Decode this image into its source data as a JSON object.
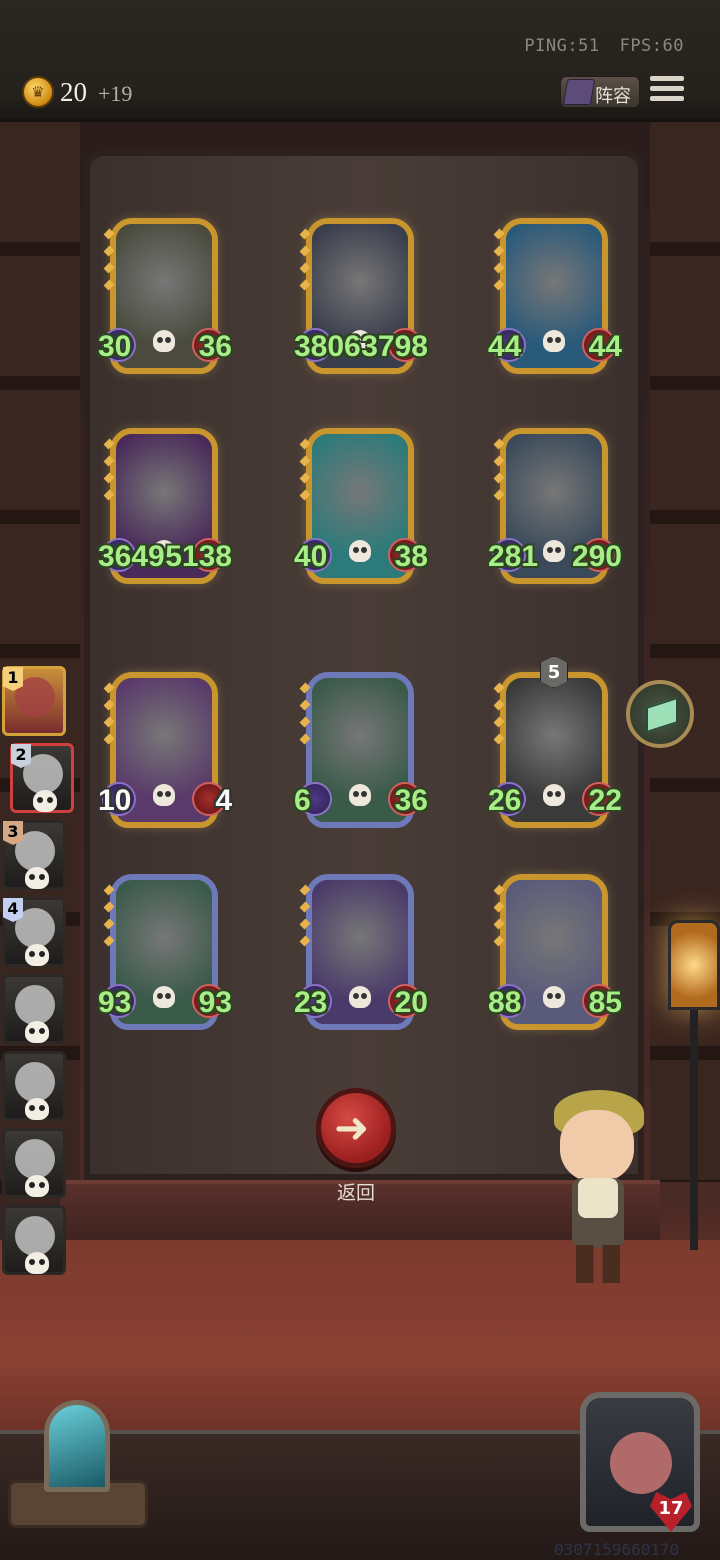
{
  "status": {
    "ping": "PING:51",
    "fps": "FPS:60"
  },
  "gold": {
    "amount": "20",
    "delta": "+19"
  },
  "top_buttons": {
    "lineup_label": "阵容"
  },
  "board": [
    {
      "atk": "30",
      "hp": "36",
      "frame": "gold",
      "art": "#4a4b3e"
    },
    {
      "atk": "3806",
      "hp": "3798",
      "frame": "gold",
      "art": "#3a3d4c"
    },
    {
      "atk": "44",
      "hp": "44",
      "frame": "gold",
      "art": "#2a5a7a"
    },
    {
      "atk": "3649",
      "hp": "5138",
      "frame": "gold",
      "art": "#4a2a5a"
    },
    {
      "atk": "40",
      "hp": "38",
      "frame": "gold",
      "art": "#2c7a7a"
    },
    {
      "atk": "281",
      "hp": "290",
      "frame": "gold",
      "art": "#3a4a5a"
    },
    {
      "atk": "10",
      "hp": "4",
      "frame": "gold",
      "art": "#5a3a6a",
      "white": true
    },
    {
      "atk": "6",
      "hp": "36",
      "frame": "blue",
      "art": "#3a5a4a"
    },
    {
      "atk": "26",
      "hp": "22",
      "frame": "gold",
      "art": "#3a3a3a",
      "level": "5"
    },
    {
      "atk": "93",
      "hp": "93",
      "frame": "blue",
      "art": "#3a5a4a"
    },
    {
      "atk": "23",
      "hp": "20",
      "frame": "blue",
      "art": "#4a3a6a"
    },
    {
      "atk": "88",
      "hp": "85",
      "frame": "gold",
      "art": "#5a5a7a"
    }
  ],
  "queue": [
    {
      "rank": "1",
      "state": "active"
    },
    {
      "rank": "2",
      "state": "selected"
    },
    {
      "rank": "3",
      "state": "dead"
    },
    {
      "rank": "4",
      "state": "dead"
    },
    {
      "rank": "",
      "state": "dead"
    },
    {
      "rank": "",
      "state": "dead"
    },
    {
      "rank": "",
      "state": "dead"
    },
    {
      "rank": "",
      "state": "dead"
    }
  ],
  "back_button": {
    "label": "返回",
    "icon": "left-arrow-icon"
  },
  "player": {
    "hp": "17"
  },
  "footer": {
    "id": "0307159660170"
  }
}
